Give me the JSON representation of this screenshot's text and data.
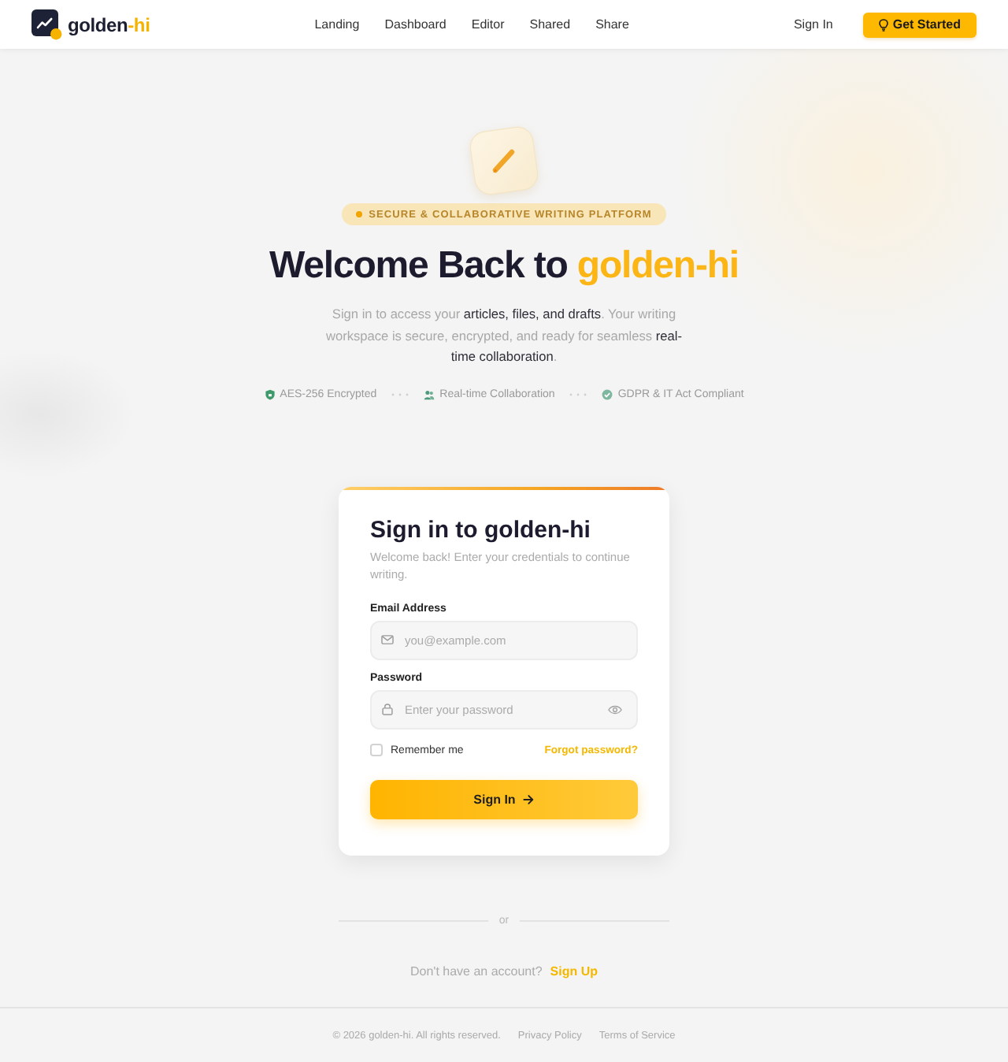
{
  "header": {
    "brand": {
      "name": "golden",
      "accent": "-hi"
    },
    "nav": [
      "Landing",
      "Dashboard",
      "Editor",
      "Shared",
      "Share"
    ],
    "sign_in": "Sign In",
    "cta": "Get Started"
  },
  "hero": {
    "badge": "SECURE & COLLABORATIVE WRITING PLATFORM",
    "title": "Welcome Back to",
    "title_accent": "golden-hi",
    "intro": "Sign in to access your **articles, files, and drafts**. Your writing workspace is secure, encrypted, and ready for seamless **real-time collaboration**.",
    "features": [
      "AES-256 Encrypted",
      "Real-time Collaboration",
      "GDPR & IT Act Compliant"
    ]
  },
  "signin_card": {
    "title": "Sign in to golden-hi",
    "subtitle": "Welcome back! Enter your credentials to continue writing.",
    "fields": [
      {
        "kind": "email",
        "label": "Email Address",
        "placeholder": "you@example.com"
      },
      {
        "kind": "password",
        "label": "Password",
        "placeholder": "Enter your password"
      }
    ],
    "remember": {
      "label": "Remember me",
      "checked": false
    },
    "forgot": "Forgot password?",
    "submit": "Sign In"
  },
  "divider": "or",
  "signup": {
    "prompt": "Don't have an account?",
    "link": "Sign Up"
  },
  "footer": {
    "copyright": "© 2026 golden-hi. All rights reserved.",
    "links": [
      "Privacy Policy",
      "Terms of Service"
    ]
  }
}
